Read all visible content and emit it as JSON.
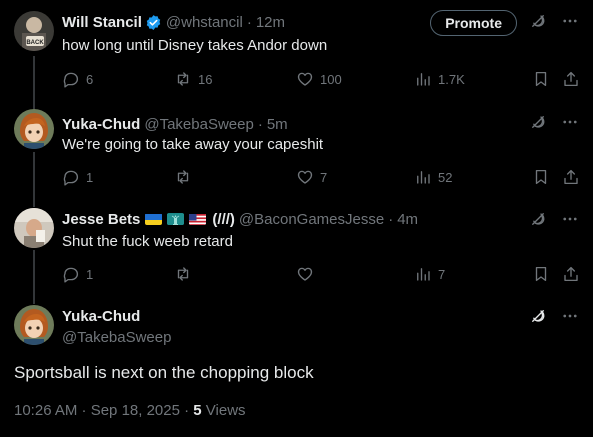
{
  "replies": [
    {
      "name": "Will Stancil",
      "verified": true,
      "handle": "@whstancil",
      "dot": "·",
      "time": "12m",
      "text": "how long until Disney takes Andor down",
      "promote_label": "Promote",
      "stats": {
        "replies": "6",
        "reposts": "16",
        "likes": "100",
        "views": "1.7K"
      }
    },
    {
      "name": "Yuka-Chud",
      "handle": "@TakebaSweep",
      "dot": "·",
      "time": "5m",
      "text": "We're going to take away your capeshit",
      "stats": {
        "replies": "1",
        "reposts": "",
        "likes": "7",
        "views": "52"
      }
    },
    {
      "name": "Jesse Bets",
      "name_suffix": "(///)",
      "flags": [
        "ukraine-flag",
        "statue-of-liberty",
        "us-flag"
      ],
      "handle": "@BaconGamesJesse",
      "dot": "·",
      "time": "4m",
      "text": "Shut the fuck weeb retard",
      "stats": {
        "replies": "1",
        "reposts": "",
        "likes": "",
        "views": "7"
      }
    }
  ],
  "main_post": {
    "name": "Yuka-Chud",
    "handle": "@TakebaSweep",
    "text": "Sportsball is next on the chopping block",
    "timestamp": "10:26 AM · Sep 18, 2025 · ",
    "views_count": "5",
    "views_label": " Views"
  },
  "colors": {
    "background": "#000000",
    "text": "#e7e9ea",
    "muted": "#71767b",
    "verified": "#1d9bf0",
    "line": "#333639"
  }
}
